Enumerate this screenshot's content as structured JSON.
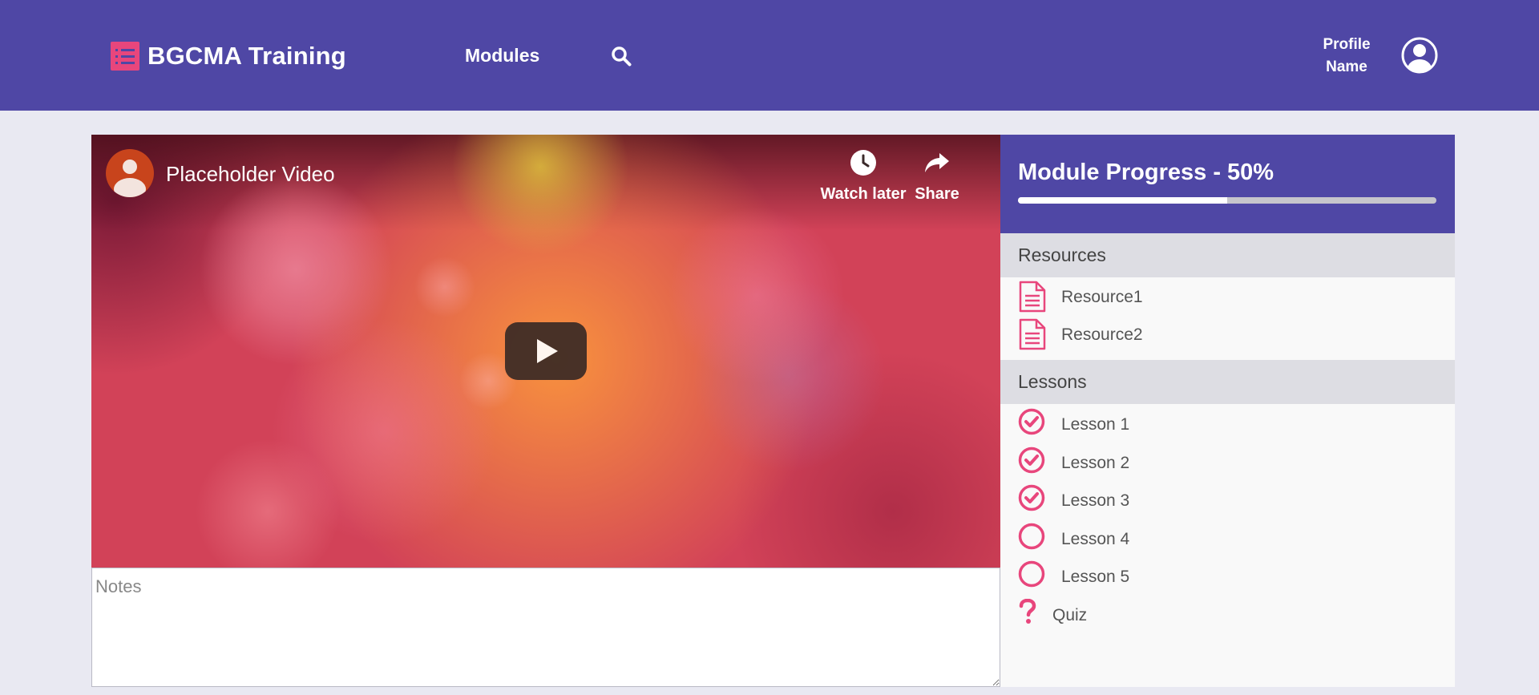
{
  "header": {
    "brand": "BGCMA Training",
    "nav_modules": "Modules",
    "profile_name_line1": "Profile",
    "profile_name_line2": "Name"
  },
  "video": {
    "title": "Placeholder Video",
    "watch_later_label": "Watch later",
    "share_label": "Share"
  },
  "notes": {
    "placeholder": "Notes",
    "value": ""
  },
  "progress": {
    "title": "Module Progress - 50%",
    "fraction": 0.5
  },
  "resources": {
    "heading": "Resources",
    "items": [
      {
        "label": "Resource1",
        "icon": "document-icon"
      },
      {
        "label": "Resource2",
        "icon": "document-icon"
      }
    ]
  },
  "lessons": {
    "heading": "Lessons",
    "items": [
      {
        "label": "Lesson 1",
        "icon": "check-circle-icon",
        "completed": true
      },
      {
        "label": "Lesson 2",
        "icon": "check-circle-icon",
        "completed": true
      },
      {
        "label": "Lesson 3",
        "icon": "check-circle-icon",
        "completed": true
      },
      {
        "label": "Lesson 4",
        "icon": "empty-circle-icon",
        "completed": false
      },
      {
        "label": "Lesson 5",
        "icon": "empty-circle-icon",
        "completed": false
      }
    ],
    "quiz": {
      "label": "Quiz",
      "icon": "question-mark-icon"
    }
  },
  "colors": {
    "primary": "#4f47a5",
    "accent": "#e8467c",
    "background": "#e9e9f2"
  }
}
